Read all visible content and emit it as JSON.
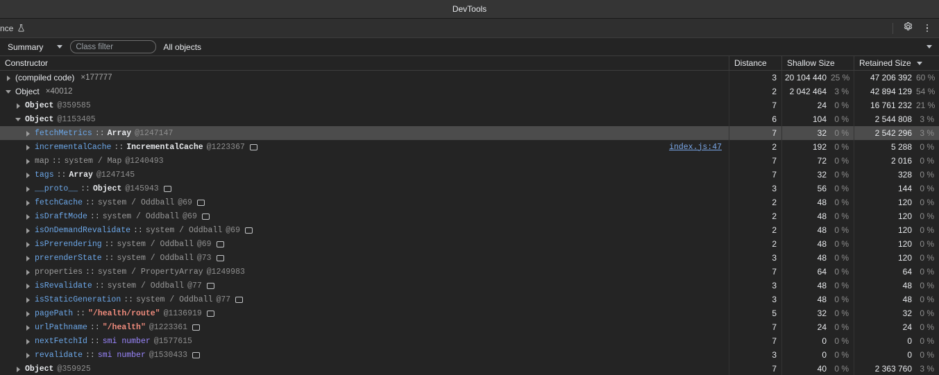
{
  "window": {
    "title": "DevTools"
  },
  "tabs": {
    "active_label": "nce",
    "flask_icon": "flask-icon",
    "settings_icon": "gear-icon",
    "more_icon": "more-vertical-icon"
  },
  "toolbar": {
    "view_mode": "Summary",
    "class_filter_value": "",
    "class_filter_placeholder": "Class filter",
    "object_scope": "All objects"
  },
  "table": {
    "columns": {
      "constructor": "Constructor",
      "distance": "Distance",
      "shallow": "Shallow Size",
      "retained": "Retained Size"
    },
    "sort_column": "Retained Size",
    "rows": [
      {
        "indent": 0,
        "twisty": "closed",
        "kind": "ctor",
        "name": "(compiled code)",
        "count": "×177777",
        "distance": "3",
        "shallow": "20 104 440",
        "shallow_pct": "25 %",
        "retained": "47 206 392",
        "retained_pct": "60 %",
        "selected": false
      },
      {
        "indent": 0,
        "twisty": "open",
        "kind": "ctor",
        "name": "Object",
        "count": "×40012",
        "distance": "2",
        "shallow": "2 042 464",
        "shallow_pct": "3 %",
        "retained": "42 894 129",
        "retained_pct": "54 %",
        "selected": false
      },
      {
        "indent": 1,
        "twisty": "closed",
        "kind": "instance",
        "name": "Object",
        "objid": "@359585",
        "distance": "7",
        "shallow": "24",
        "shallow_pct": "0 %",
        "retained": "16 761 232",
        "retained_pct": "21 %",
        "selected": false
      },
      {
        "indent": 1,
        "twisty": "open",
        "kind": "instance",
        "name": "Object",
        "objid": "@1153405",
        "distance": "6",
        "shallow": "104",
        "shallow_pct": "0 %",
        "retained": "2 544 808",
        "retained_pct": "3 %",
        "selected": false
      },
      {
        "indent": 2,
        "twisty": "closed",
        "kind": "prop",
        "prop": "fetchMetrics",
        "prop_dim": false,
        "type": "Array",
        "type_style": "obj",
        "objid": "@1247147",
        "box": false,
        "distance": "7",
        "shallow": "32",
        "shallow_pct": "0 %",
        "retained": "2 542 296",
        "retained_pct": "3 %",
        "selected": true
      },
      {
        "indent": 2,
        "twisty": "closed",
        "kind": "prop",
        "prop": "incrementalCache",
        "prop_dim": false,
        "type": "IncrementalCache",
        "type_style": "obj",
        "objid": "@1223367",
        "box": true,
        "link": "index.js:47",
        "distance": "2",
        "shallow": "192",
        "shallow_pct": "0 %",
        "retained": "5 288",
        "retained_pct": "0 %",
        "selected": false
      },
      {
        "indent": 2,
        "twisty": "closed",
        "kind": "prop",
        "prop": "map",
        "prop_dim": true,
        "type": "system / Map",
        "type_style": "sys",
        "objid": "@1240493",
        "box": false,
        "distance": "7",
        "shallow": "72",
        "shallow_pct": "0 %",
        "retained": "2 016",
        "retained_pct": "0 %",
        "selected": false
      },
      {
        "indent": 2,
        "twisty": "closed",
        "kind": "prop",
        "prop": "tags",
        "prop_dim": false,
        "type": "Array",
        "type_style": "obj",
        "objid": "@1247145",
        "box": false,
        "distance": "7",
        "shallow": "32",
        "shallow_pct": "0 %",
        "retained": "328",
        "retained_pct": "0 %",
        "selected": false
      },
      {
        "indent": 2,
        "twisty": "closed",
        "kind": "prop",
        "prop": "__proto__",
        "prop_dim": false,
        "type": "Object",
        "type_style": "obj",
        "objid": "@145943",
        "box": true,
        "distance": "3",
        "shallow": "56",
        "shallow_pct": "0 %",
        "retained": "144",
        "retained_pct": "0 %",
        "selected": false
      },
      {
        "indent": 2,
        "twisty": "closed",
        "kind": "prop",
        "prop": "fetchCache",
        "prop_dim": false,
        "type": "system / Oddball",
        "type_style": "sys",
        "objid": "@69",
        "box": true,
        "distance": "2",
        "shallow": "48",
        "shallow_pct": "0 %",
        "retained": "120",
        "retained_pct": "0 %",
        "selected": false
      },
      {
        "indent": 2,
        "twisty": "closed",
        "kind": "prop",
        "prop": "isDraftMode",
        "prop_dim": false,
        "type": "system / Oddball",
        "type_style": "sys",
        "objid": "@69",
        "box": true,
        "distance": "2",
        "shallow": "48",
        "shallow_pct": "0 %",
        "retained": "120",
        "retained_pct": "0 %",
        "selected": false
      },
      {
        "indent": 2,
        "twisty": "closed",
        "kind": "prop",
        "prop": "isOnDemandRevalidate",
        "prop_dim": false,
        "type": "system / Oddball",
        "type_style": "sys",
        "objid": "@69",
        "box": true,
        "distance": "2",
        "shallow": "48",
        "shallow_pct": "0 %",
        "retained": "120",
        "retained_pct": "0 %",
        "selected": false
      },
      {
        "indent": 2,
        "twisty": "closed",
        "kind": "prop",
        "prop": "isPrerendering",
        "prop_dim": false,
        "type": "system / Oddball",
        "type_style": "sys",
        "objid": "@69",
        "box": true,
        "distance": "2",
        "shallow": "48",
        "shallow_pct": "0 %",
        "retained": "120",
        "retained_pct": "0 %",
        "selected": false
      },
      {
        "indent": 2,
        "twisty": "closed",
        "kind": "prop",
        "prop": "prerenderState",
        "prop_dim": false,
        "type": "system / Oddball",
        "type_style": "sys",
        "objid": "@73",
        "box": true,
        "distance": "3",
        "shallow": "48",
        "shallow_pct": "0 %",
        "retained": "120",
        "retained_pct": "0 %",
        "selected": false
      },
      {
        "indent": 2,
        "twisty": "closed",
        "kind": "prop",
        "prop": "properties",
        "prop_dim": true,
        "type": "system / PropertyArray",
        "type_style": "sys",
        "objid": "@1249983",
        "box": false,
        "distance": "7",
        "shallow": "64",
        "shallow_pct": "0 %",
        "retained": "64",
        "retained_pct": "0 %",
        "selected": false
      },
      {
        "indent": 2,
        "twisty": "closed",
        "kind": "prop",
        "prop": "isRevalidate",
        "prop_dim": false,
        "type": "system / Oddball",
        "type_style": "sys",
        "objid": "@77",
        "box": true,
        "distance": "3",
        "shallow": "48",
        "shallow_pct": "0 %",
        "retained": "48",
        "retained_pct": "0 %",
        "selected": false
      },
      {
        "indent": 2,
        "twisty": "closed",
        "kind": "prop",
        "prop": "isStaticGeneration",
        "prop_dim": false,
        "type": "system / Oddball",
        "type_style": "sys",
        "objid": "@77",
        "box": true,
        "distance": "3",
        "shallow": "48",
        "shallow_pct": "0 %",
        "retained": "48",
        "retained_pct": "0 %",
        "selected": false
      },
      {
        "indent": 2,
        "twisty": "closed",
        "kind": "prop",
        "prop": "pagePath",
        "prop_dim": false,
        "type": "\"/health/route\"",
        "type_style": "str",
        "objid": "@1136919",
        "box": true,
        "distance": "5",
        "shallow": "32",
        "shallow_pct": "0 %",
        "retained": "32",
        "retained_pct": "0 %",
        "selected": false
      },
      {
        "indent": 2,
        "twisty": "closed",
        "kind": "prop",
        "prop": "urlPathname",
        "prop_dim": false,
        "type": "\"/health\"",
        "type_style": "str",
        "objid": "@1223361",
        "box": true,
        "distance": "7",
        "shallow": "24",
        "shallow_pct": "0 %",
        "retained": "24",
        "retained_pct": "0 %",
        "selected": false
      },
      {
        "indent": 2,
        "twisty": "closed",
        "kind": "prop",
        "prop": "nextFetchId",
        "prop_dim": false,
        "type": "smi number",
        "type_style": "smi",
        "objid": "@1577615",
        "box": false,
        "distance": "7",
        "shallow": "0",
        "shallow_pct": "0 %",
        "retained": "0",
        "retained_pct": "0 %",
        "selected": false
      },
      {
        "indent": 2,
        "twisty": "closed",
        "kind": "prop",
        "prop": "revalidate",
        "prop_dim": false,
        "type": "smi number",
        "type_style": "smi",
        "objid": "@1530433",
        "box": true,
        "distance": "3",
        "shallow": "0",
        "shallow_pct": "0 %",
        "retained": "0",
        "retained_pct": "0 %",
        "selected": false
      },
      {
        "indent": 1,
        "twisty": "closed",
        "kind": "instance",
        "name": "Object",
        "objid": "@359925",
        "distance": "7",
        "shallow": "40",
        "shallow_pct": "0 %",
        "retained": "2 363 760",
        "retained_pct": "3 %",
        "selected": false
      }
    ]
  }
}
